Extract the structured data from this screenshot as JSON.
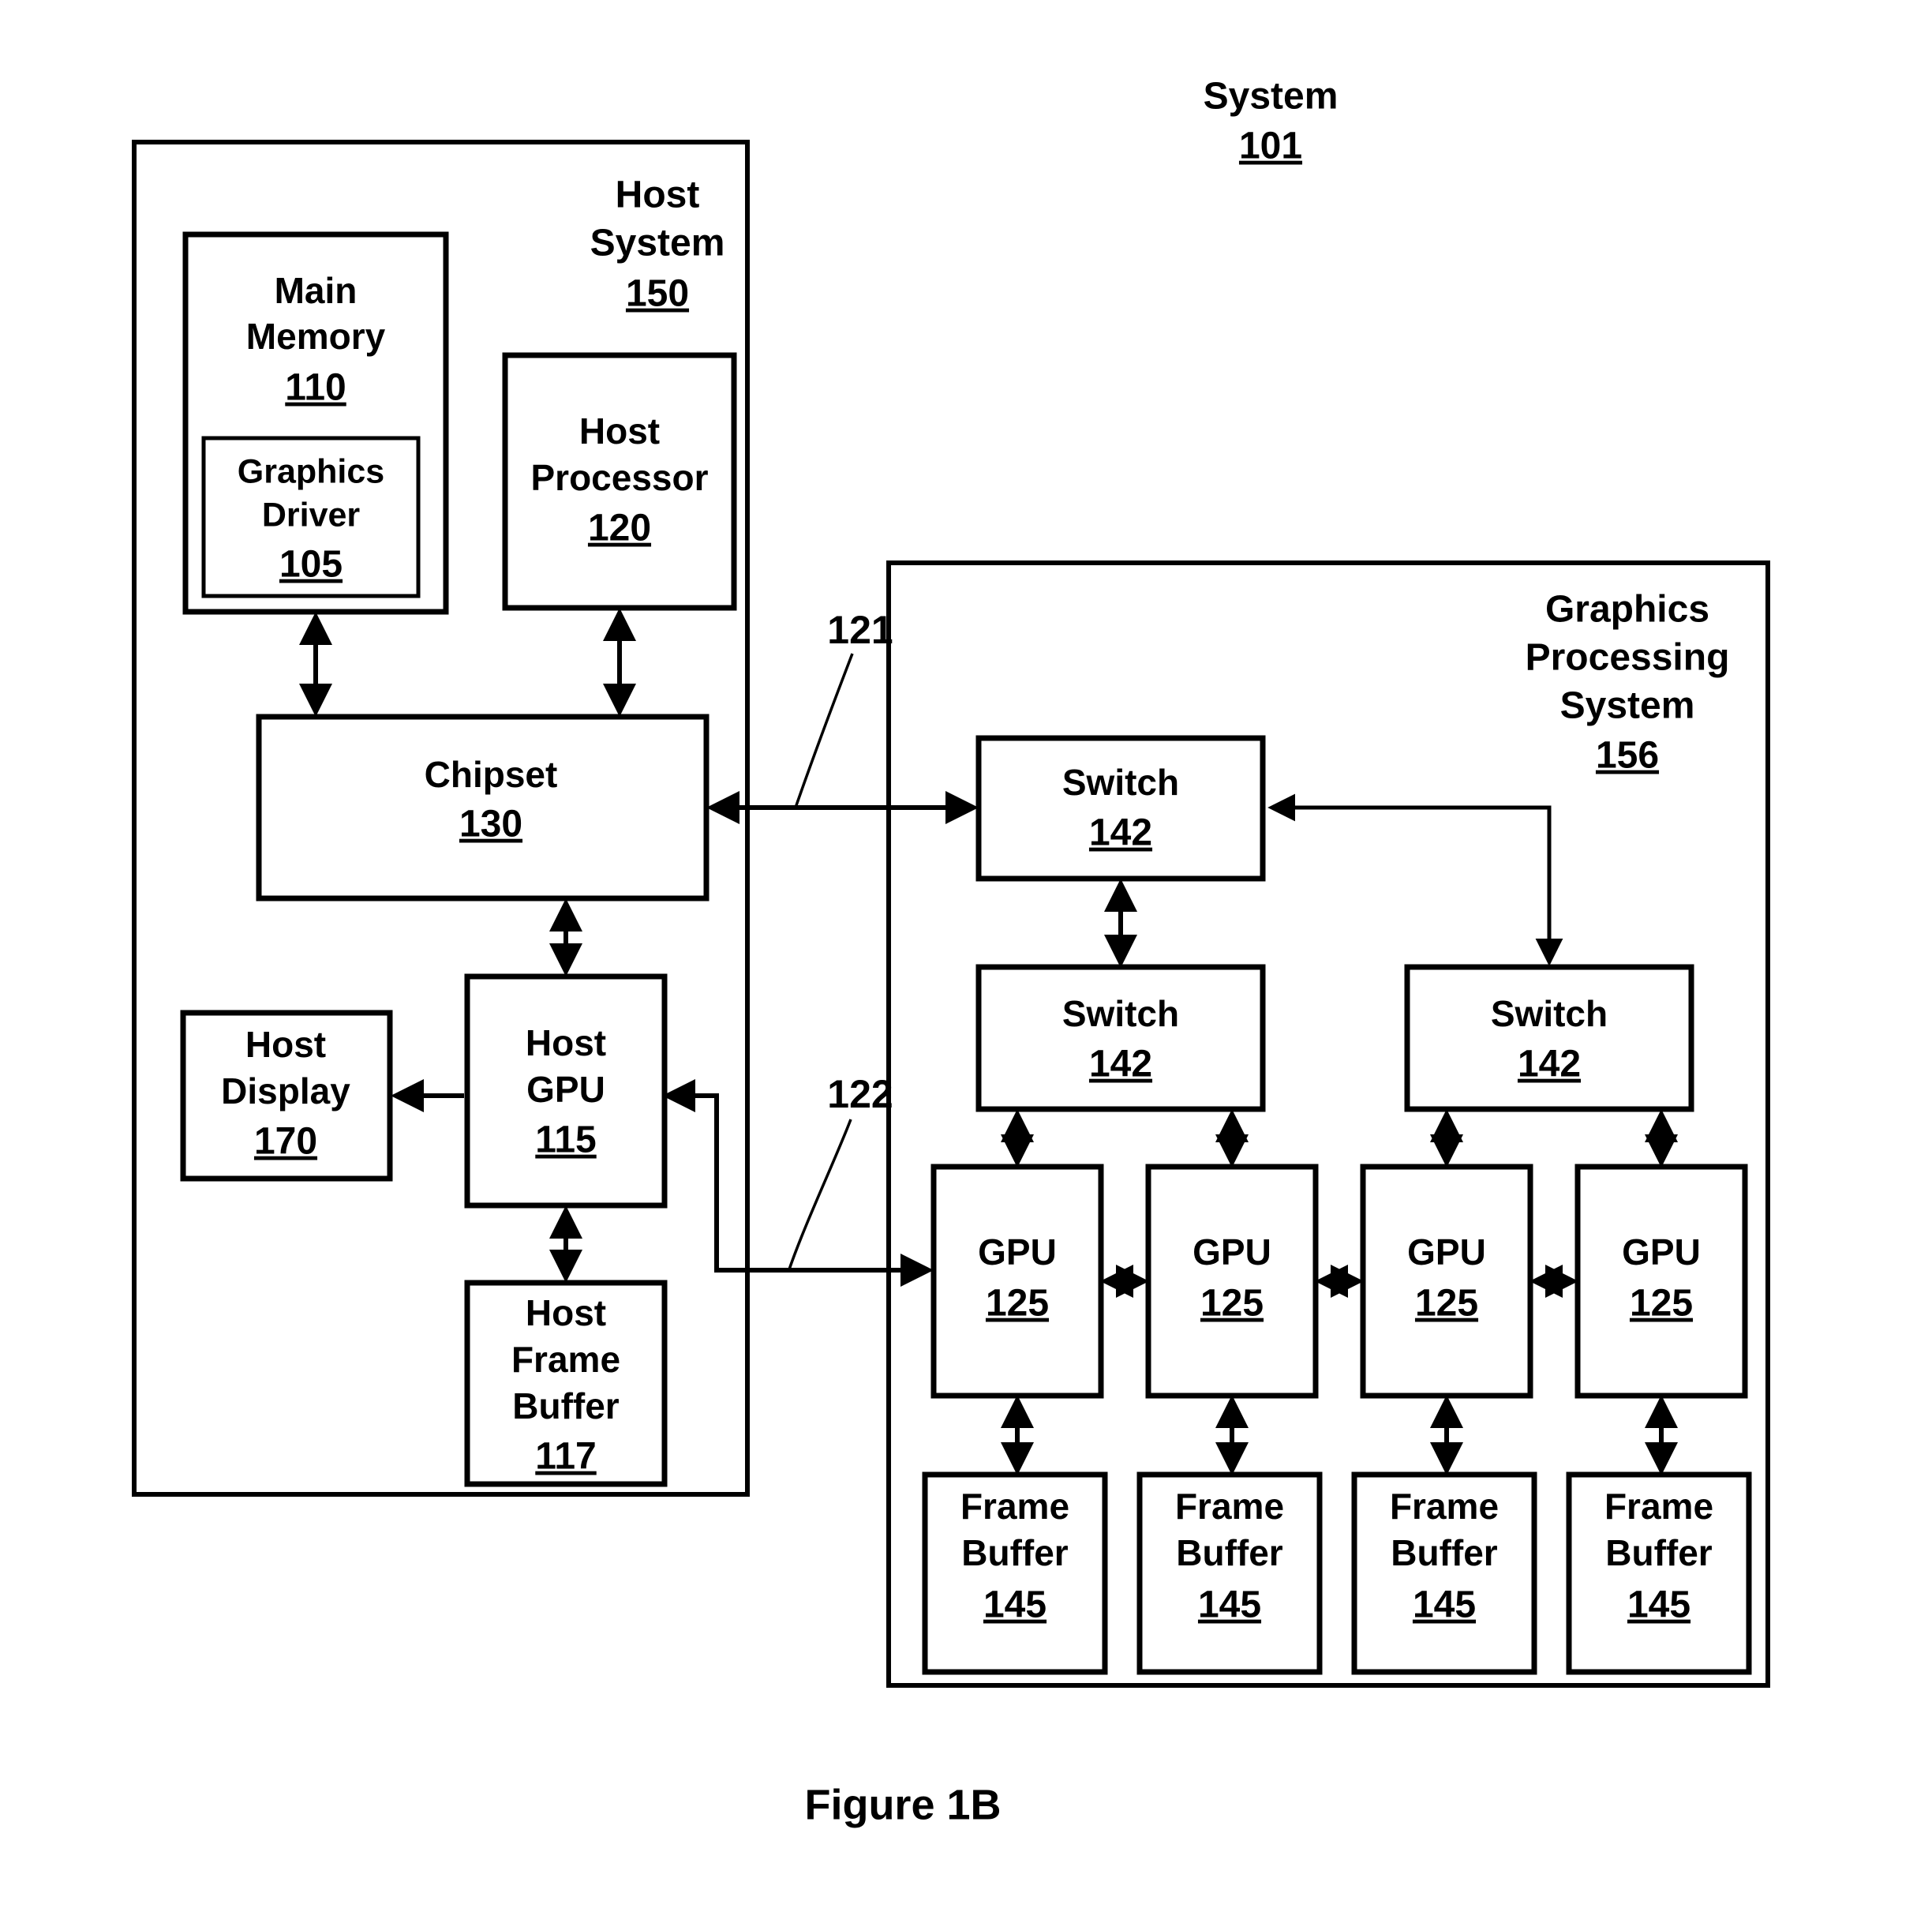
{
  "figure": {
    "caption": "Figure 1B",
    "title": "System",
    "title_ref": "101"
  },
  "host_system": {
    "label_line1": "Host",
    "label_line2": "System",
    "ref": "150",
    "blocks": {
      "main_memory": {
        "line1": "Main",
        "line2": "Memory",
        "ref": "110"
      },
      "graphics_driver": {
        "line1": "Graphics",
        "line2": "Driver",
        "ref": "105"
      },
      "host_processor": {
        "line1": "Host",
        "line2": "Processor",
        "ref": "120"
      },
      "chipset": {
        "line1": "Chipset",
        "ref": "130"
      },
      "host_display": {
        "line1": "Host",
        "line2": "Display",
        "ref": "170"
      },
      "host_gpu": {
        "line1": "Host",
        "line2": "GPU",
        "ref": "115"
      },
      "host_frame_buffer": {
        "line1": "Host",
        "line2": "Frame",
        "line3": "Buffer",
        "ref": "117"
      }
    }
  },
  "graphics_processing_system": {
    "label_line1": "Graphics",
    "label_line2": "Processing",
    "label_line3": "System",
    "ref": "156",
    "switches": [
      {
        "name": "Switch",
        "ref": "142"
      },
      {
        "name": "Switch",
        "ref": "142"
      },
      {
        "name": "Switch",
        "ref": "142"
      }
    ],
    "gpus": [
      {
        "name": "GPU",
        "ref": "125"
      },
      {
        "name": "GPU",
        "ref": "125"
      },
      {
        "name": "GPU",
        "ref": "125"
      },
      {
        "name": "GPU",
        "ref": "125"
      }
    ],
    "frame_buffers": [
      {
        "line1": "Frame",
        "line2": "Buffer",
        "ref": "145"
      },
      {
        "line1": "Frame",
        "line2": "Buffer",
        "ref": "145"
      },
      {
        "line1": "Frame",
        "line2": "Buffer",
        "ref": "145"
      },
      {
        "line1": "Frame",
        "line2": "Buffer",
        "ref": "145"
      }
    ]
  },
  "connectors": {
    "bus_121": "121",
    "bus_122": "122"
  },
  "colors": {
    "stroke": "#000000",
    "background": "#ffffff"
  }
}
